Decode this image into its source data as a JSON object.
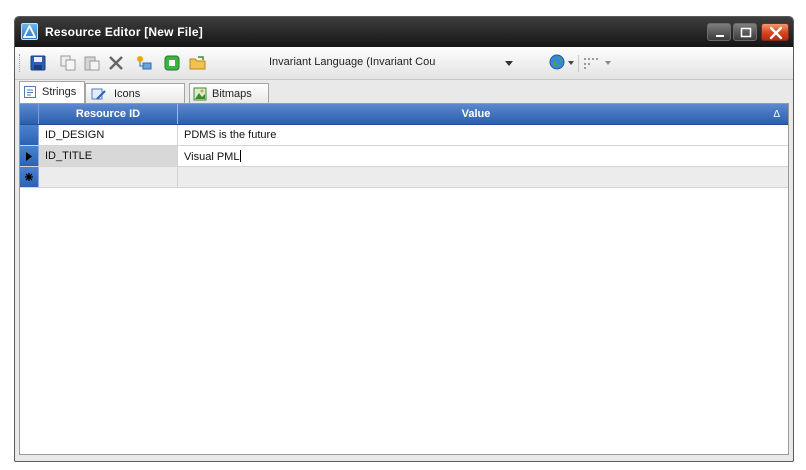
{
  "window": {
    "title": "Resource Editor [New File]"
  },
  "toolbar": {
    "language_value": "Invariant Language (Invariant Cou",
    "icons": [
      "save-icon",
      "copy-icon",
      "paste-icon",
      "delete-icon",
      "rename-icon",
      "add-icon",
      "open-folder-icon",
      "globe-icon",
      "resource-format-icon"
    ]
  },
  "tabs": [
    {
      "label": "Strings",
      "icon": "strings-tab-icon",
      "active": true
    },
    {
      "label": "Icons",
      "icon": "icons-tab-icon",
      "active": false
    },
    {
      "label": "Bitmaps",
      "icon": "bitmaps-tab-icon",
      "active": false
    }
  ],
  "grid": {
    "columns": [
      "Resource ID",
      "Value"
    ],
    "sort_indicator": "Δ",
    "rows": [
      {
        "id": "ID_DESIGN",
        "value": "PDMS is the future",
        "state": "normal"
      },
      {
        "id": "ID_TITLE",
        "value": "Visual PML",
        "state": "editing"
      },
      {
        "id": "",
        "value": "",
        "state": "new"
      }
    ]
  },
  "colors": {
    "header": "#3f73c1",
    "close_button": "#d8431d",
    "titlebar": "#222222"
  }
}
